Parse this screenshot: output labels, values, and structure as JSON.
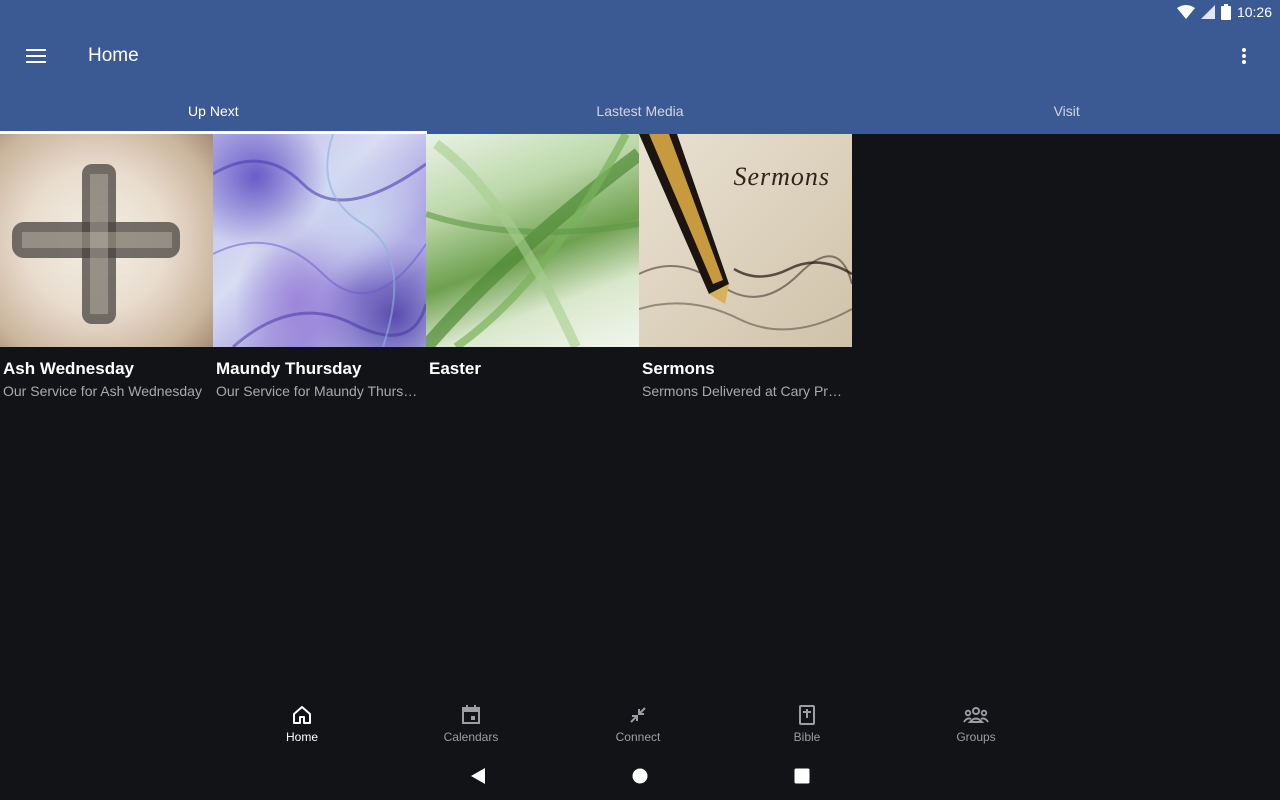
{
  "status_bar": {
    "time": "10:26"
  },
  "app_bar": {
    "title": "Home"
  },
  "tabs": [
    {
      "label": "Up Next",
      "active": true
    },
    {
      "label": "Lastest Media",
      "active": false
    },
    {
      "label": "Visit",
      "active": false
    }
  ],
  "cards": [
    {
      "title": "Ash Wednesday",
      "subtitle": "Our Service for Ash Wednesday"
    },
    {
      "title": "Maundy Thursday",
      "subtitle": "Our Service for Maundy Thursday"
    },
    {
      "title": "Easter",
      "subtitle": ""
    },
    {
      "title": "Sermons",
      "subtitle": "Sermons Delivered at Cary Pres…",
      "image_text": "Sermons"
    }
  ],
  "bottom_nav": [
    {
      "label": "Home",
      "icon": "home-icon",
      "active": true
    },
    {
      "label": "Calendars",
      "icon": "calendar-icon",
      "active": false
    },
    {
      "label": "Connect",
      "icon": "connect-icon",
      "active": false
    },
    {
      "label": "Bible",
      "icon": "bible-icon",
      "active": false
    },
    {
      "label": "Groups",
      "icon": "groups-icon",
      "active": false
    }
  ],
  "colors": {
    "primary": "#3b5a93",
    "background": "#121316",
    "inactive_nav": "#9c9ea3"
  }
}
